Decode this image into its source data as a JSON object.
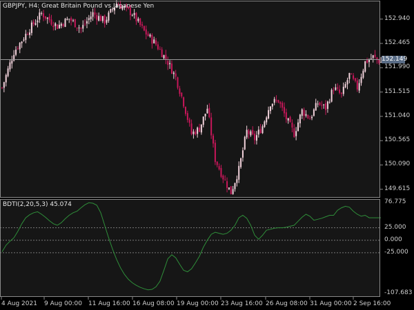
{
  "symbol_title": "GBPJPY, H4:  Great Britain Pound vs Japanese Yen",
  "indicator_title": "BDTI(2,20,5,3) 45.074",
  "current_price": "152.149",
  "colors": {
    "background": "#000000",
    "panel": "#161616",
    "grid_border": "#8a8a8a",
    "candle_up": "#f3d3dc",
    "candle_down": "#c8175a",
    "indicator_line": "#2f8f3a",
    "level_line": "#7a7a7a",
    "price_line": "#9a9a9a"
  },
  "price_axis_labels": [
    "152.940",
    "152.465",
    "151.990",
    "151.515",
    "151.040",
    "150.565",
    "150.090",
    "149.615"
  ],
  "indicator_axis_labels": [
    "76.775",
    "25.000",
    "0.000",
    "-25.000",
    "-107.683"
  ],
  "time_axis_labels": [
    "4 Aug 2021",
    "9 Aug 00:00",
    "11 Aug 16:00",
    "16 Aug 08:00",
    "19 Aug 00:00",
    "23 Aug 16:00",
    "26 Aug 08:00",
    "31 Aug 00:00",
    "2 Sep 16:00"
  ],
  "chart_data": [
    {
      "type": "candlestick",
      "title": "GBPJPY, H4:  Great Britain Pound vs Japanese Yen",
      "ylim": [
        149.45,
        153.3
      ],
      "y_ticks": [
        152.94,
        152.465,
        151.99,
        151.515,
        151.04,
        150.565,
        150.09,
        149.615
      ],
      "last_price": 152.149,
      "close_path": [
        [
          0,
          151.6
        ],
        [
          6,
          152.3
        ],
        [
          14,
          152.75
        ],
        [
          20,
          153.05
        ],
        [
          28,
          152.8
        ],
        [
          34,
          152.95
        ],
        [
          40,
          152.75
        ],
        [
          46,
          153.05
        ],
        [
          52,
          152.9
        ],
        [
          58,
          153.25
        ],
        [
          66,
          153.05
        ],
        [
          72,
          152.7
        ],
        [
          78,
          152.45
        ],
        [
          84,
          152.1
        ],
        [
          88,
          151.8
        ],
        [
          92,
          151.3
        ],
        [
          96,
          150.7
        ],
        [
          100,
          150.8
        ],
        [
          104,
          151.2
        ],
        [
          108,
          150.2
        ],
        [
          112,
          149.85
        ],
        [
          116,
          149.55
        ],
        [
          120,
          150.0
        ],
        [
          124,
          150.75
        ],
        [
          128,
          150.6
        ],
        [
          132,
          150.85
        ],
        [
          136,
          151.3
        ],
        [
          140,
          151.35
        ],
        [
          144,
          151.0
        ],
        [
          148,
          150.7
        ],
        [
          152,
          151.15
        ],
        [
          156,
          151.0
        ],
        [
          160,
          151.3
        ],
        [
          164,
          151.2
        ],
        [
          168,
          151.6
        ],
        [
          172,
          151.45
        ],
        [
          176,
          151.85
        ],
        [
          180,
          151.6
        ],
        [
          184,
          152.1
        ],
        [
          188,
          152.2
        ],
        [
          192,
          152.1
        ]
      ]
    },
    {
      "type": "line",
      "title": "BDTI(2,20,5,3) 45.074",
      "ylim": [
        -107.683,
        76.775
      ],
      "levels": [
        25,
        0,
        -25
      ],
      "series": [
        {
          "name": "BDTI(2,20,5,3)",
          "x": [
            0,
            2,
            4,
            6,
            8,
            10,
            12,
            14,
            16,
            18,
            20,
            22,
            24,
            26,
            28,
            30,
            32,
            34,
            36,
            38,
            40,
            42,
            44,
            46,
            48,
            50,
            52,
            54,
            56,
            58,
            60,
            62,
            64,
            66,
            68,
            70,
            72,
            74,
            76,
            78,
            80,
            82,
            84,
            86,
            88,
            90,
            92,
            94,
            96,
            98,
            100,
            102,
            104,
            106,
            108,
            110,
            112,
            114,
            116,
            118,
            120,
            122,
            124,
            126,
            128,
            130,
            132,
            134,
            136,
            138,
            140,
            142,
            144,
            146,
            148,
            150,
            152,
            154,
            156,
            158,
            160,
            162,
            164,
            166,
            168,
            170,
            172,
            174,
            176,
            178,
            180,
            182,
            184,
            186,
            188,
            190,
            192
          ],
          "values": [
            -23,
            -10,
            -2,
            5,
            18,
            33,
            45,
            51,
            55,
            57,
            52,
            46,
            39,
            33,
            30,
            35,
            43,
            50,
            55,
            58,
            65,
            71,
            75,
            74,
            70,
            55,
            30,
            5,
            -18,
            -38,
            -55,
            -68,
            -78,
            -85,
            -90,
            -94,
            -97,
            -99,
            -98,
            -93,
            -82,
            -60,
            -37,
            -29,
            -35,
            -48,
            -60,
            -63,
            -57,
            -45,
            -32,
            -14,
            0,
            12,
            16,
            14,
            12,
            14,
            20,
            30,
            45,
            50,
            44,
            30,
            10,
            2,
            10,
            20,
            22,
            24,
            25,
            25,
            26,
            28,
            30,
            38,
            46,
            52,
            48,
            40,
            42,
            44,
            47,
            50,
            50,
            60,
            65,
            68,
            66,
            58,
            52,
            48,
            50,
            45,
            45,
            45,
            45
          ]
        }
      ]
    }
  ]
}
